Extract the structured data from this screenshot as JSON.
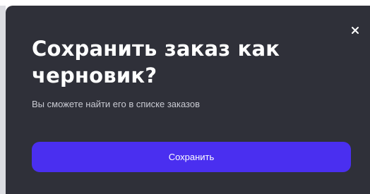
{
  "dialog": {
    "title": "Сохранить заказ как черновик?",
    "subtitle": "Вы сможете найти его в списке заказов",
    "save_label": "Сохранить",
    "close_icon": "close-icon"
  },
  "colors": {
    "dialog_bg": "#2f3039",
    "accent": "#4a2ff0",
    "title_text": "#ffffff",
    "subtitle_text": "#c9cad2"
  }
}
